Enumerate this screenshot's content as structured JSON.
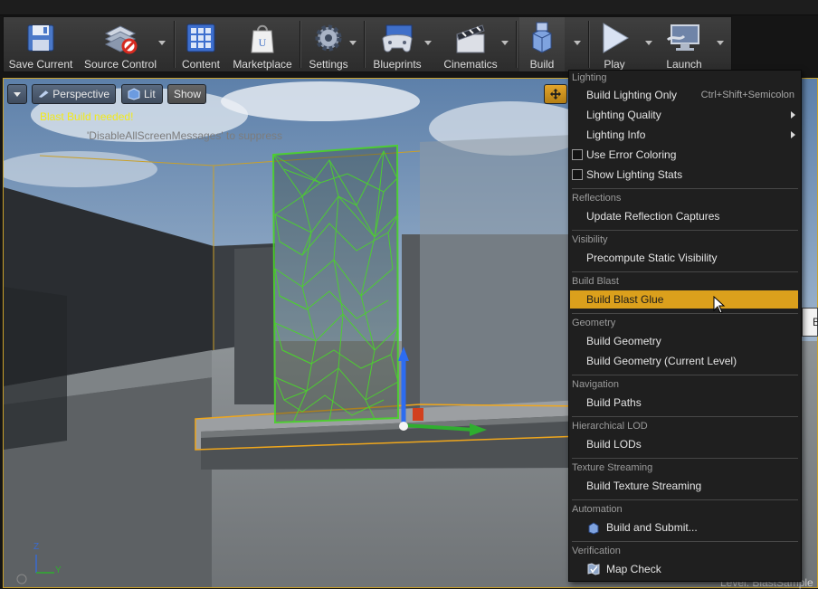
{
  "toolbar": {
    "save_current": "Save Current",
    "source_control": "Source Control",
    "content": "Content",
    "marketplace": "Marketplace",
    "settings": "Settings",
    "blueprints": "Blueprints",
    "cinematics": "Cinematics",
    "build": "Build",
    "play": "Play",
    "launch": "Launch"
  },
  "viewport": {
    "perspective": "Perspective",
    "lit": "Lit",
    "show": "Show",
    "warning": "Blast Build needed!",
    "suppress_hint": "'DisableAllScreenMessages' to suppress",
    "level_text": "Level:  BlastSample",
    "axis_z": "Z",
    "axis_y": "Y",
    "side_tab": "B"
  },
  "menu": {
    "lighting": {
      "header": "Lighting",
      "build_lighting_only": "Build Lighting Only",
      "build_lighting_shortcut": "Ctrl+Shift+Semicolon",
      "lighting_quality": "Lighting Quality",
      "lighting_info": "Lighting Info",
      "use_error_coloring": "Use Error Coloring",
      "show_lighting_stats": "Show Lighting Stats"
    },
    "reflections": {
      "header": "Reflections",
      "update_captures": "Update Reflection Captures"
    },
    "visibility": {
      "header": "Visibility",
      "precompute": "Precompute Static Visibility"
    },
    "build_blast": {
      "header": "Build Blast",
      "build_blast_glue": "Build Blast Glue"
    },
    "geometry": {
      "header": "Geometry",
      "build_geometry": "Build Geometry",
      "build_geometry_current": "Build Geometry (Current Level)"
    },
    "navigation": {
      "header": "Navigation",
      "build_paths": "Build Paths"
    },
    "hlod": {
      "header": "Hierarchical LOD",
      "build_lods": "Build LODs"
    },
    "texture_streaming": {
      "header": "Texture Streaming",
      "build_texture_streaming": "Build Texture Streaming"
    },
    "automation": {
      "header": "Automation",
      "build_and_submit": "Build and Submit..."
    },
    "verification": {
      "header": "Verification",
      "map_check": "Map Check"
    }
  },
  "colors": {
    "highlight": "#dba01c",
    "warning_text": "#f2ea1a",
    "wireframe": "#4cd12e",
    "selection": "#f0a71c"
  }
}
